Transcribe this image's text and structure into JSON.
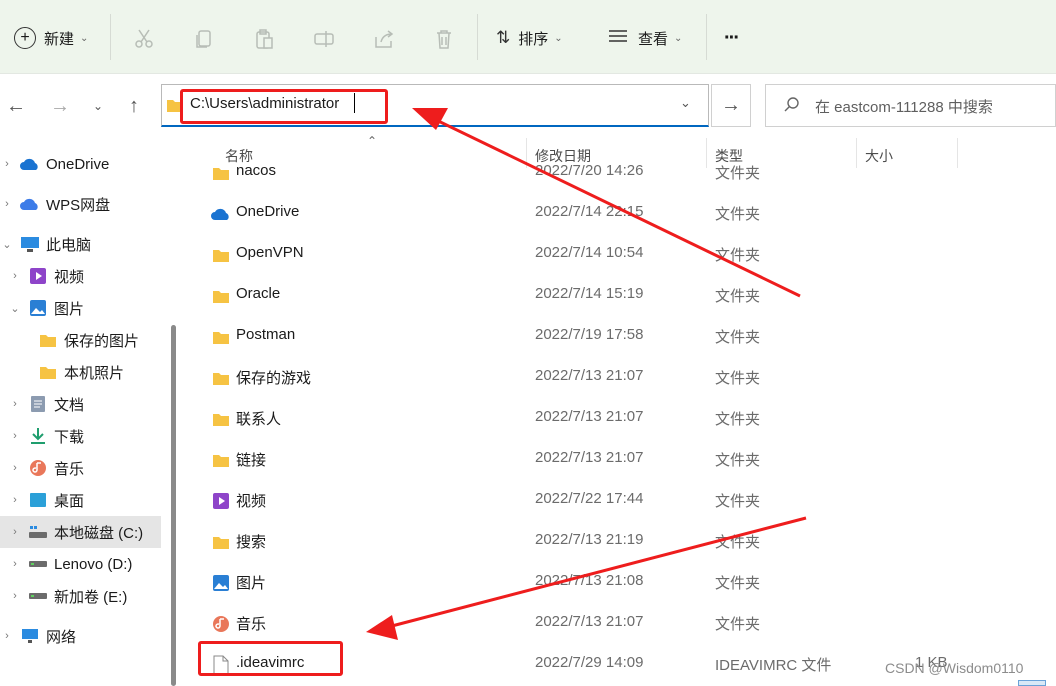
{
  "toolbar": {
    "new_label": "新建",
    "sort_label": "排序",
    "view_label": "查看",
    "more_label": "···"
  },
  "address": {
    "path": "C:\\Users\\administrator",
    "search_placeholder": "在 eastcom-111288 中搜索"
  },
  "sidebar": {
    "items": [
      {
        "label": "OneDrive"
      },
      {
        "label": "WPS网盘"
      },
      {
        "label": "此电脑"
      },
      {
        "label": "视频"
      },
      {
        "label": "图片"
      },
      {
        "label": "保存的图片"
      },
      {
        "label": "本机照片"
      },
      {
        "label": "文档"
      },
      {
        "label": "下载"
      },
      {
        "label": "音乐"
      },
      {
        "label": "桌面"
      },
      {
        "label": "本地磁盘 (C:)"
      },
      {
        "label": "Lenovo (D:)"
      },
      {
        "label": "新加卷 (E:)"
      },
      {
        "label": "网络"
      }
    ]
  },
  "columns": {
    "name": "名称",
    "date": "修改日期",
    "type": "类型",
    "size": "大小"
  },
  "files": [
    {
      "name": "nacos",
      "date": "2022/7/20 14:26",
      "type": "文件夹",
      "size": "",
      "icon": "folder-icon"
    },
    {
      "name": "OneDrive",
      "date": "2022/7/14 22:15",
      "type": "文件夹",
      "size": "",
      "icon": "onedrive-icon"
    },
    {
      "name": "OpenVPN",
      "date": "2022/7/14 10:54",
      "type": "文件夹",
      "size": "",
      "icon": "folder-icon"
    },
    {
      "name": "Oracle",
      "date": "2022/7/14 15:19",
      "type": "文件夹",
      "size": "",
      "icon": "folder-icon"
    },
    {
      "name": "Postman",
      "date": "2022/7/19 17:58",
      "type": "文件夹",
      "size": "",
      "icon": "folder-icon"
    },
    {
      "name": "保存的游戏",
      "date": "2022/7/13 21:07",
      "type": "文件夹",
      "size": "",
      "icon": "folder-icon"
    },
    {
      "name": "联系人",
      "date": "2022/7/13 21:07",
      "type": "文件夹",
      "size": "",
      "icon": "folder-icon"
    },
    {
      "name": "链接",
      "date": "2022/7/13 21:07",
      "type": "文件夹",
      "size": "",
      "icon": "folder-icon"
    },
    {
      "name": "视频",
      "date": "2022/7/22 17:44",
      "type": "文件夹",
      "size": "",
      "icon": "video-icon"
    },
    {
      "name": "搜索",
      "date": "2022/7/13 21:19",
      "type": "文件夹",
      "size": "",
      "icon": "folder-icon"
    },
    {
      "name": "图片",
      "date": "2022/7/13 21:08",
      "type": "文件夹",
      "size": "",
      "icon": "picture-icon"
    },
    {
      "name": "音乐",
      "date": "2022/7/13 21:07",
      "type": "文件夹",
      "size": "",
      "icon": "music-icon"
    },
    {
      "name": ".ideavimrc",
      "date": "2022/7/29 14:09",
      "type": "IDEAVIMRC 文件",
      "size": "1 KB",
      "icon": "file-icon"
    }
  ],
  "watermark": "CSDN @Wisdom0110",
  "colors": {
    "toolbar_bg": "#eef5ec",
    "accent": "#0067c0",
    "annotation": "#ee1d1d",
    "folder": "#f6c343",
    "selected_bg": "#e5e5e5"
  }
}
